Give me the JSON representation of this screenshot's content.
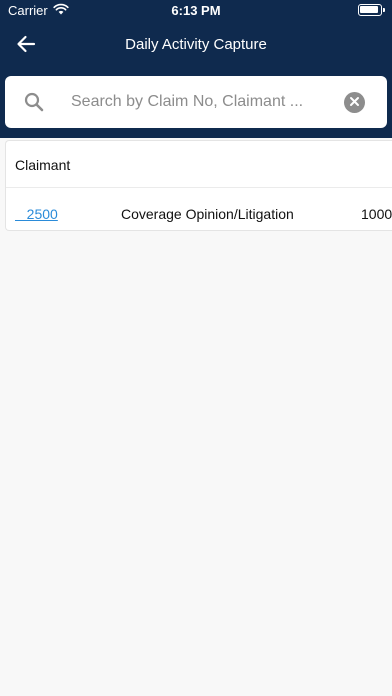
{
  "status_bar": {
    "carrier": "Carrier",
    "time": "6:13 PM"
  },
  "nav": {
    "title": "Daily Activity Capture",
    "back_icon": "arrow-left-icon"
  },
  "search": {
    "placeholder": "Search by Claim No, Claimant ...",
    "value": "",
    "search_icon": "search-icon",
    "clear_icon": "clear-icon"
  },
  "table": {
    "columns": [
      "Claimant"
    ],
    "rows": [
      {
        "claim": "   2500",
        "activity_type": "Coverage Opinion/Litigation",
        "amount": "1000"
      }
    ]
  },
  "colors": {
    "header_bg": "#0f2a4e",
    "link": "#2a8bd9",
    "page_bg": "#f8f8f8"
  }
}
